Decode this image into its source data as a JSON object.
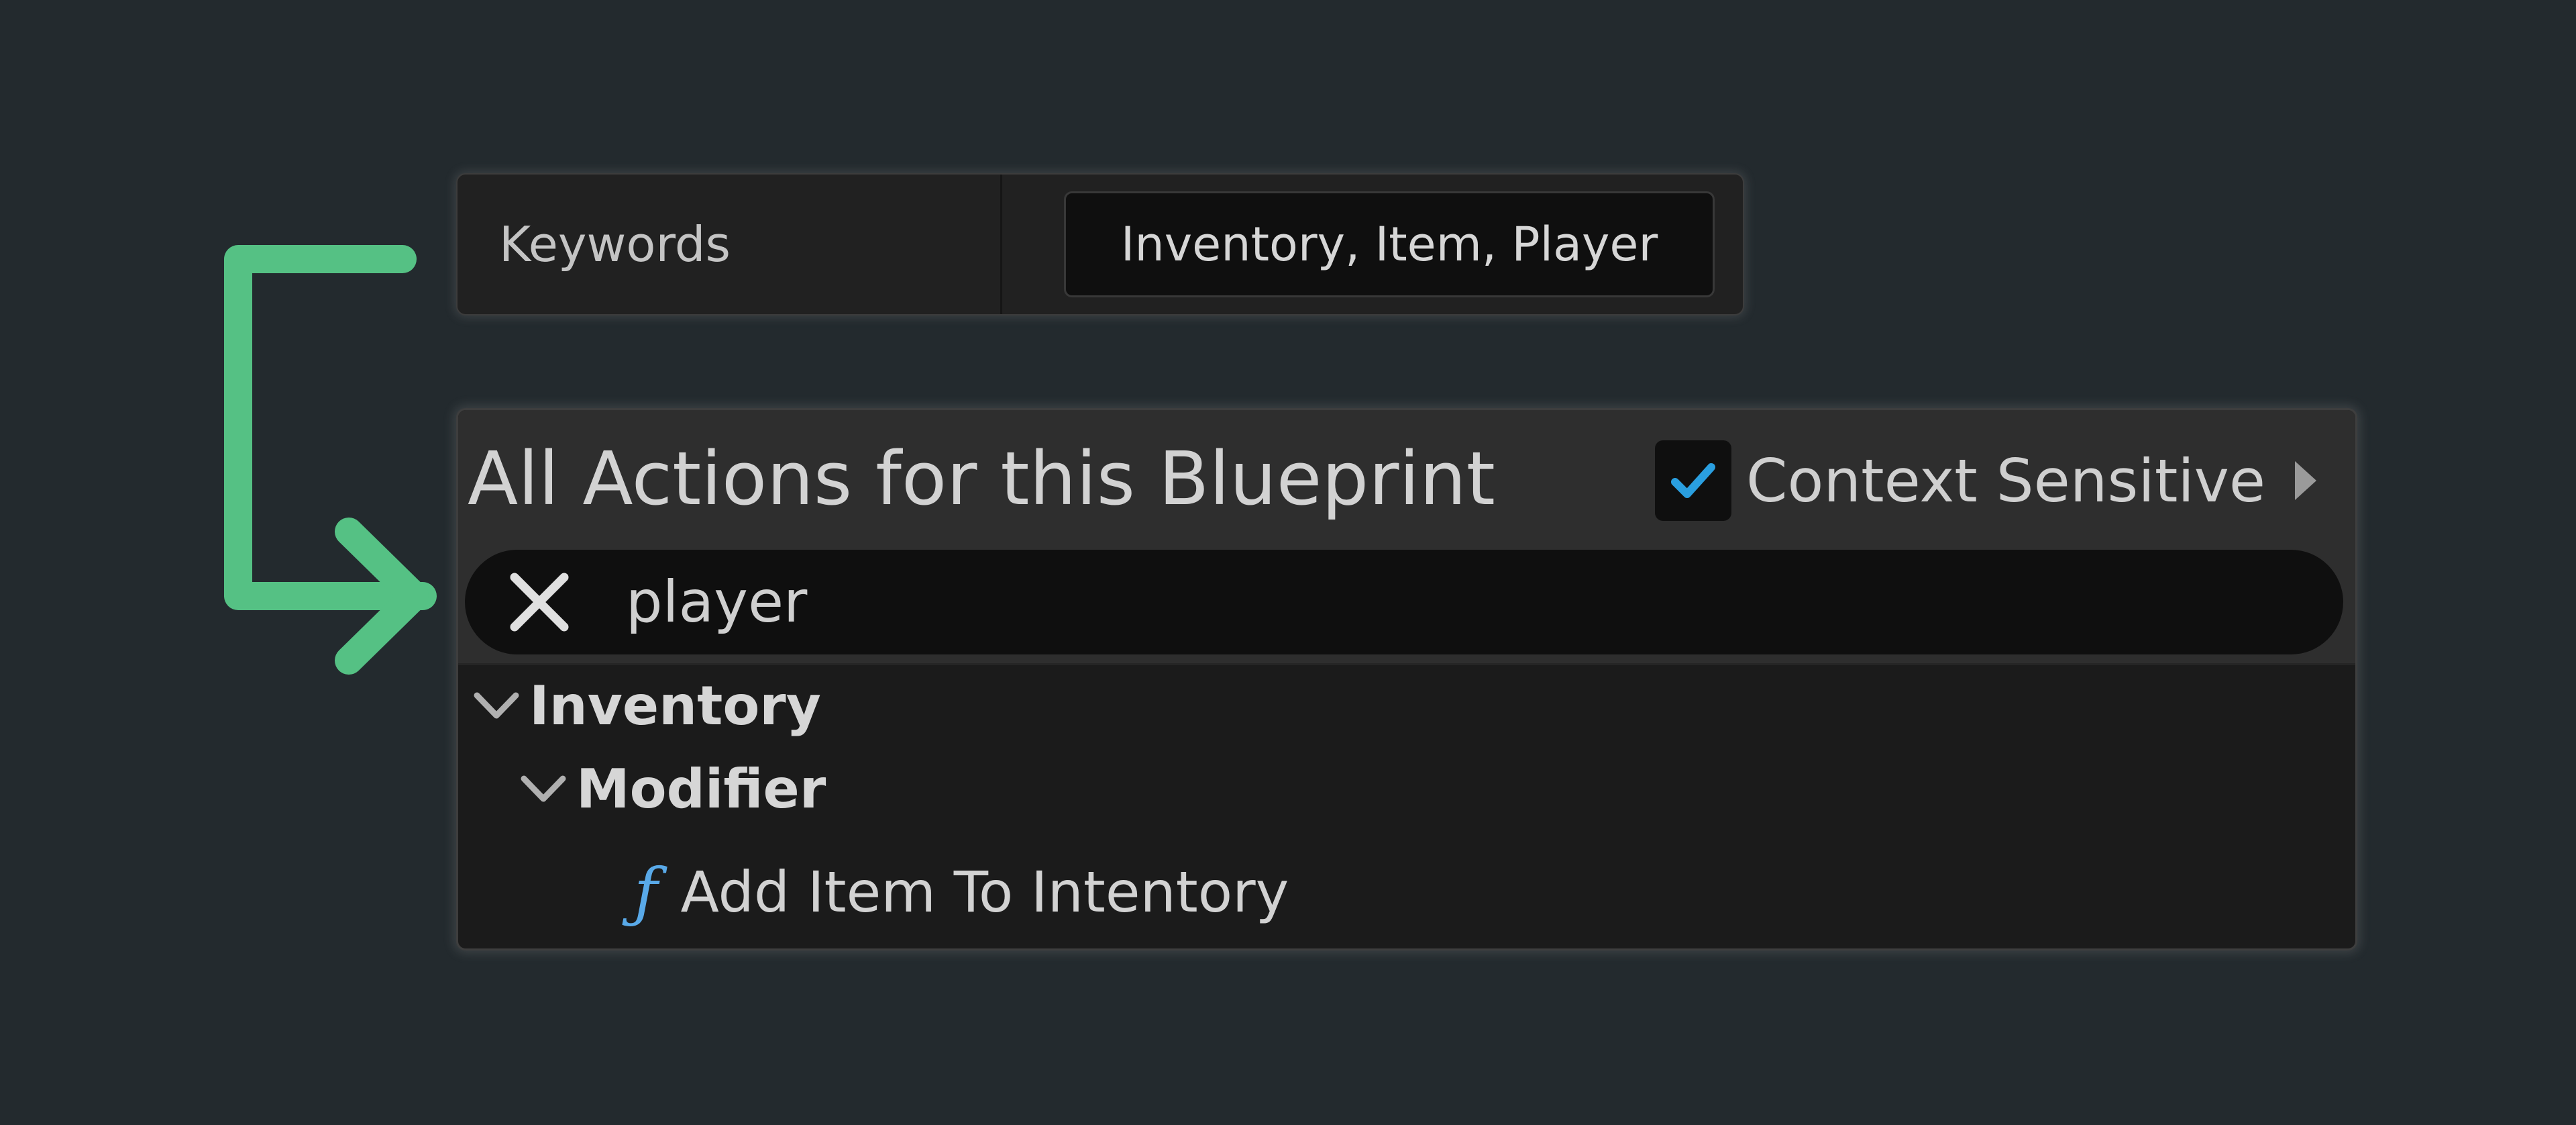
{
  "keywords": {
    "label": "Keywords",
    "value": "Inventory, Item, Player"
  },
  "action_menu": {
    "title": "All Actions for this Blueprint",
    "context_sensitive": {
      "label": "Context Sensitive",
      "checked": true
    },
    "search": {
      "query": "player",
      "clear_icon": "close-icon"
    },
    "tree": {
      "category": "Inventory",
      "subcategory": "Modifier",
      "action": {
        "icon": "function-icon",
        "label": "Add Item To Intentory"
      }
    }
  },
  "colors": {
    "background": "#232a2e",
    "arrow": "#55c184",
    "checkmark": "#2a9fe0",
    "function_icon": "#59a9e8"
  }
}
